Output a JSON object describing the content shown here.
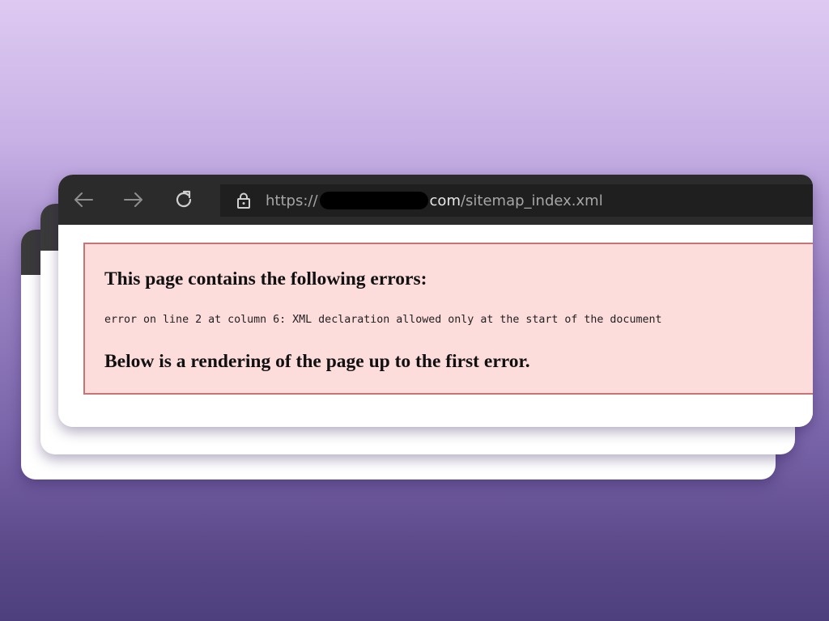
{
  "browser": {
    "url_prefix": "https://",
    "url_domain_suffix": "com",
    "url_path": "/sitemap_index.xml"
  },
  "error_page": {
    "heading": "This page contains the following errors:",
    "detail": "error on line 2 at column 6: XML declaration allowed only at the start of the document",
    "footer": "Below is a rendering of the page up to the first error."
  },
  "colors": {
    "toolbar": "#2b2b2b",
    "address_bar": "#1f1f1f",
    "error_background": "#fddcdc",
    "error_border": "#c97474"
  },
  "icons": [
    "back-arrow-icon",
    "forward-arrow-icon",
    "refresh-icon",
    "lock-icon"
  ]
}
